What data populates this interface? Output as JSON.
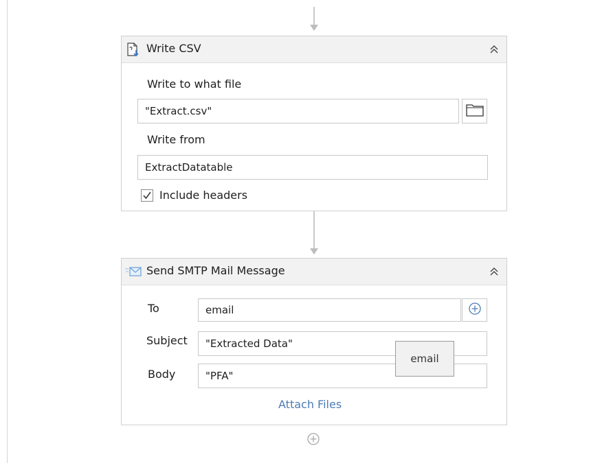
{
  "write_csv": {
    "title": "Write CSV",
    "icon": "write-csv-file-icon",
    "collapse_icon": "double-chevron-up-icon",
    "file_label": "Write to what file",
    "file_value": "\"Extract.csv\"",
    "browse_icon": "folder-icon",
    "from_label": "Write from",
    "from_value": "ExtractDatatable",
    "include_headers_label": "Include headers",
    "include_headers_checked": true
  },
  "send_smtp": {
    "title": "Send SMTP Mail Message",
    "icon": "envelope-icon",
    "collapse_icon": "double-chevron-up-icon",
    "to_label": "To",
    "to_value": "email",
    "add_icon": "plus-circle-icon",
    "subject_label": "Subject",
    "subject_value": "\"Extracted Data\"",
    "body_label": "Body",
    "body_value": "\"PFA\"",
    "attach_files_label": "Attach Files"
  },
  "tooltip": {
    "text": "email"
  },
  "colors": {
    "header_bg": "#f2f2f2",
    "border": "#cfcfcf",
    "link": "#4c7bb5",
    "connector": "#c9c9c9",
    "envelope": "#6a9fd4"
  }
}
